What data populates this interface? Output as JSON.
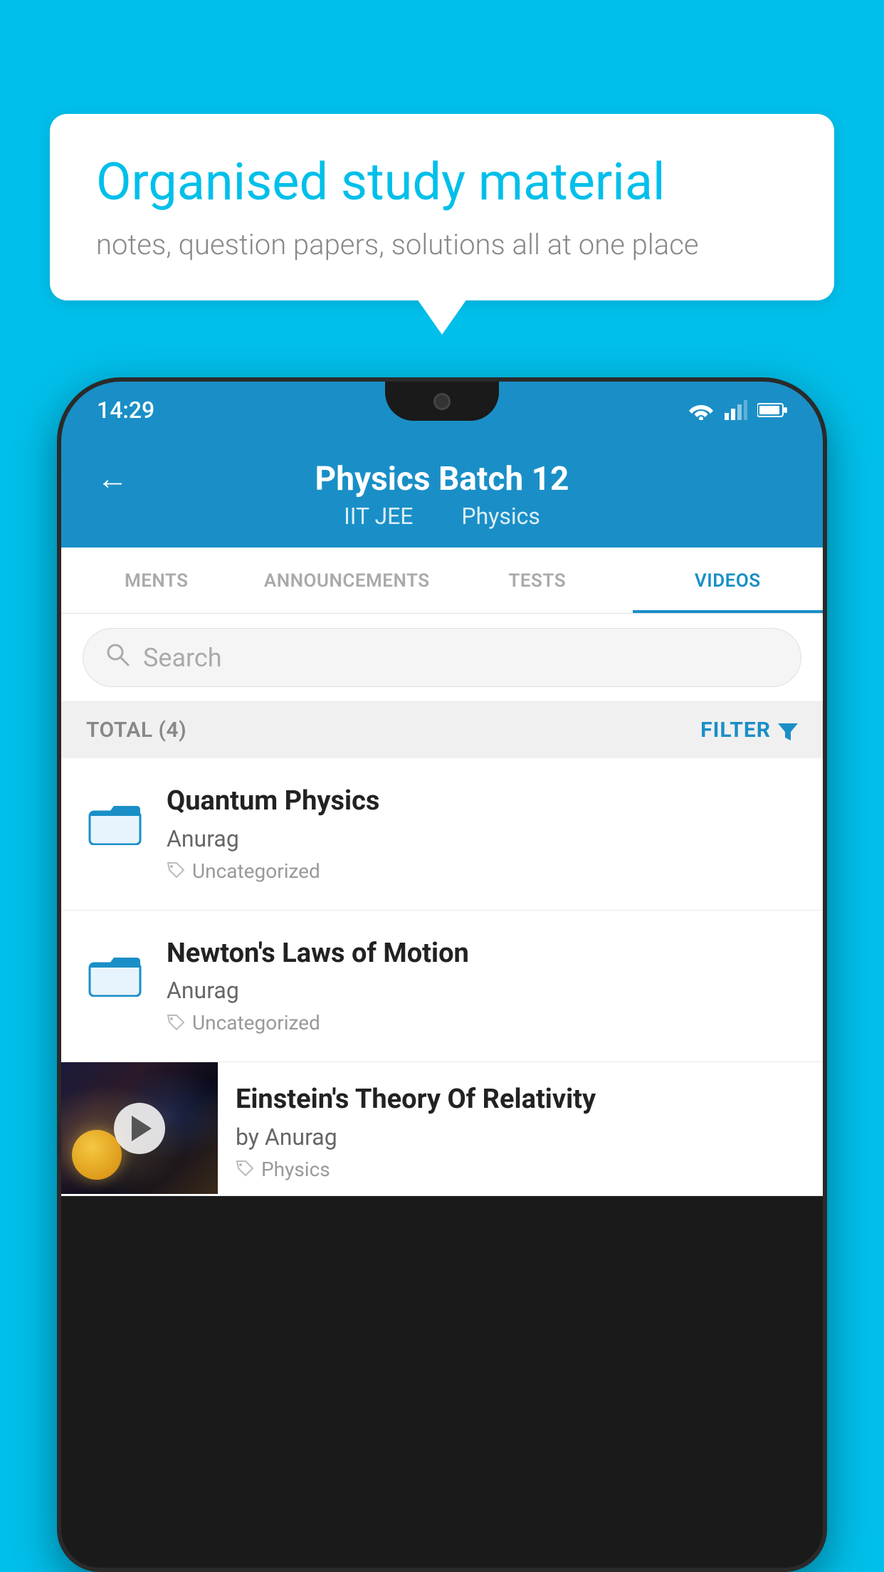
{
  "background_color": "#00BFEA",
  "speech_bubble": {
    "heading": "Organised study material",
    "subtext": "notes, question papers, solutions all at one place"
  },
  "phone": {
    "status_bar": {
      "time": "14:29"
    },
    "header": {
      "back_label": "←",
      "title": "Physics Batch 12",
      "subtitle_part1": "IIT JEE",
      "subtitle_part2": "Physics"
    },
    "tabs": [
      {
        "label": "MENTS",
        "active": false
      },
      {
        "label": "ANNOUNCEMENTS",
        "active": false
      },
      {
        "label": "TESTS",
        "active": false
      },
      {
        "label": "VIDEOS",
        "active": true
      }
    ],
    "search": {
      "placeholder": "Search"
    },
    "filter_row": {
      "total_label": "TOTAL (4)",
      "filter_label": "FILTER"
    },
    "videos": [
      {
        "id": "v1",
        "title": "Quantum Physics",
        "author": "Anurag",
        "tag": "Uncategorized",
        "has_thumbnail": false
      },
      {
        "id": "v2",
        "title": "Newton's Laws of Motion",
        "author": "Anurag",
        "tag": "Uncategorized",
        "has_thumbnail": false
      },
      {
        "id": "v3",
        "title": "Einstein's Theory Of Relativity",
        "author": "by Anurag",
        "tag": "Physics",
        "has_thumbnail": true
      }
    ]
  }
}
